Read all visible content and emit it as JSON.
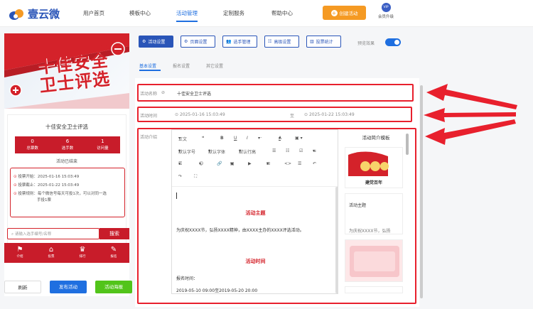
{
  "brand": {
    "name": "壹云微"
  },
  "nav": {
    "items": [
      "用户首页",
      "模板中心",
      "活动管理",
      "定制服务",
      "帮助中心"
    ],
    "create_label": "创建活动",
    "vip_badge": "VIP",
    "upgrade_label": "会员升级"
  },
  "preview": {
    "poster_title_1": "十佳安全",
    "poster_title_2": "卫士评选",
    "activity_name": "十佳安全卫士评选",
    "stats": [
      {
        "value": "0",
        "label": "总票数"
      },
      {
        "value": "6",
        "label": "选手数"
      },
      {
        "value": "1",
        "label": "访问量"
      }
    ],
    "ended_text": "活动已结束",
    "vote_start": "投票开始：2025-01-16 15:03:49",
    "vote_end": "投票截止：2025-01-22 15:03:49",
    "vote_rule_1": "投票规则：每个微信号每天可投1次，可以对同一选",
    "vote_rule_2": "手投1票",
    "search_placeholder": "请输入选手编号/名称",
    "search_button": "搜索",
    "tabbar": [
      "介绍",
      "投票",
      "排行",
      "报名"
    ]
  },
  "actions": {
    "refresh": "刷新",
    "publish": "发布活动",
    "publish_poster": "活动海报"
  },
  "toolbar": {
    "tabs": [
      "活动设置",
      "页面设置",
      "选手管理",
      "高级设置",
      "投票统计"
    ],
    "preview_label": "预览效果",
    "preview_enabled": true
  },
  "subtabs": [
    "基本设置",
    "报名设置",
    "其它设置"
  ],
  "form": {
    "name_label": "活动名称",
    "name_value": "十佳安全卫士评选",
    "time_label": "活动时间",
    "start_time": "2025-01-16 15:03:49",
    "to_label": "至",
    "end_time": "2025-01-22 15:03:49",
    "intro_label": "活动介绍"
  },
  "editor": {
    "tools_row1": [
      "正文",
      "❝",
      "B",
      "U",
      "I",
      "···",
      "A",
      "A"
    ],
    "tools_row2": [
      "默认字号",
      "默认字体",
      "默认行高",
      "☰",
      "☷",
      "☑",
      "≡"
    ],
    "tools_row3": [
      "☰",
      "☺",
      "🔗",
      "▣",
      "▶",
      "⊞",
      "<>",
      "☰",
      "↶"
    ],
    "tools_row4": [
      "↷",
      "⛶"
    ],
    "heading_1": "活动主题",
    "body_1": "为庆祝XXXX节，弘扬XXXX精神，由XXXX主办的XXXX评选活动。",
    "heading_2": "活动时间",
    "body_2": "报名时间：",
    "body_3": "2019-05-10 09:00至2019-05-20 20:00"
  },
  "templates": {
    "title": "活动简介模板",
    "items": [
      "建党百年",
      "活动主题",
      "为庆祝XXXX节，弘扬"
    ]
  },
  "colors": {
    "brand_red": "#c81c2a",
    "primary_blue": "#2a55b8",
    "orange": "#f59a23",
    "green": "#52c41a"
  }
}
